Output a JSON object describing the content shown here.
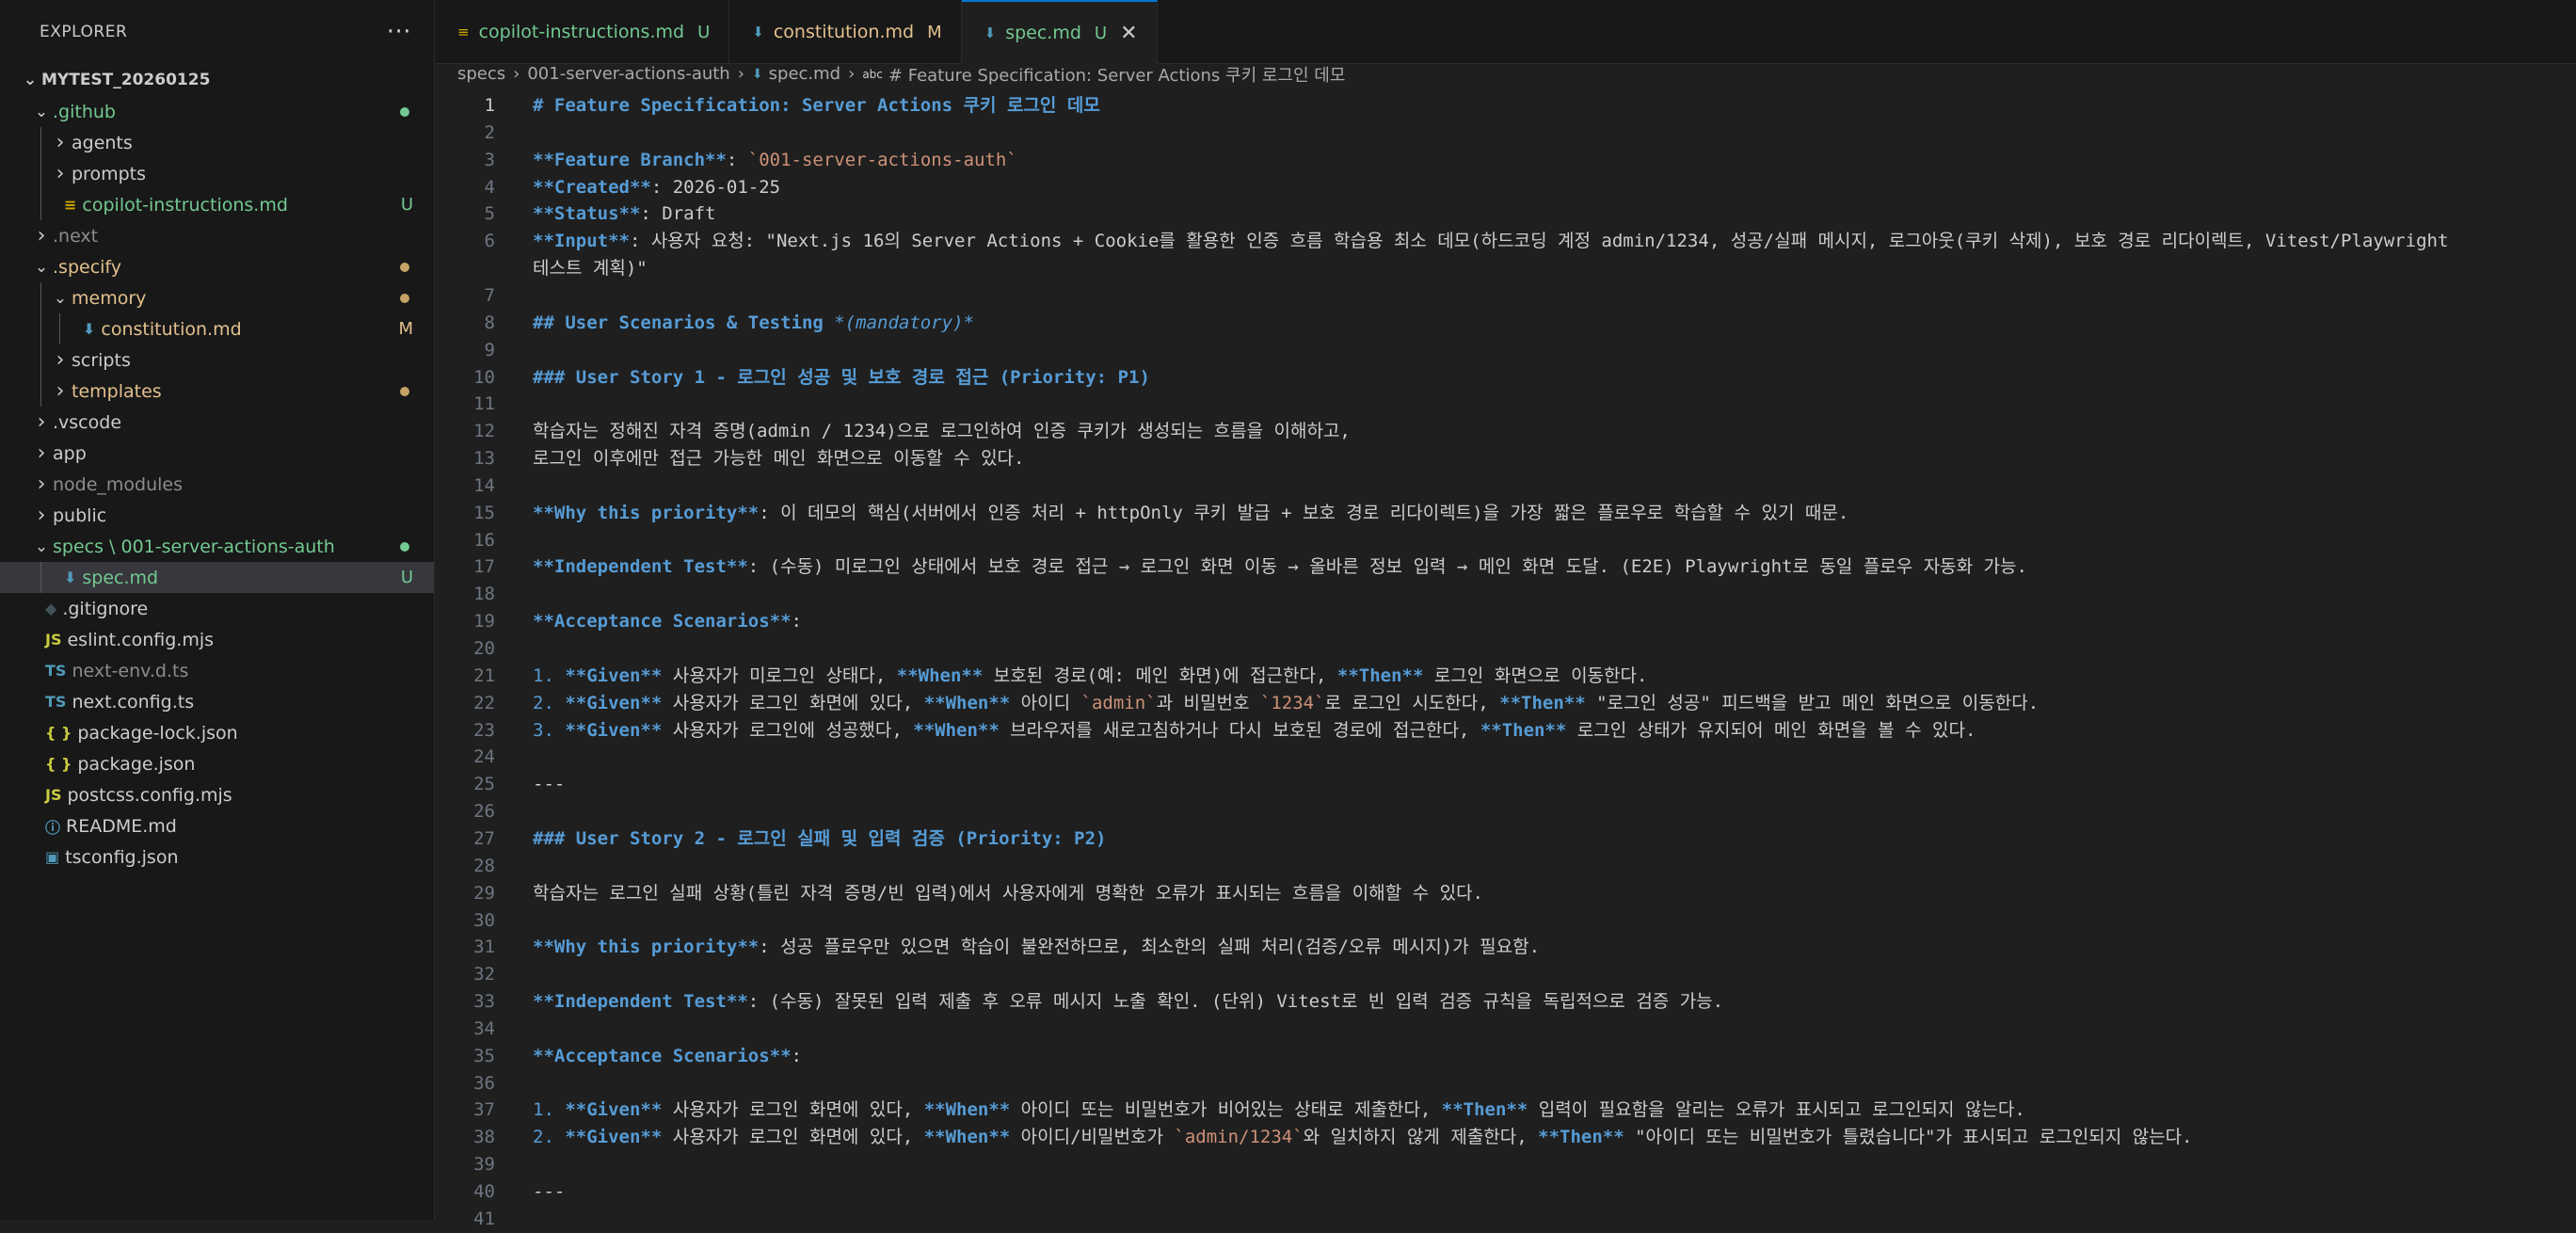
{
  "explorer": {
    "title": "EXPLORER",
    "more_icon": "···",
    "workspace": "MYTEST_20260125",
    "items": [
      {
        "label": ".github",
        "depth": 1,
        "chevron": "down",
        "color": "#73c991",
        "dot": "#73c991"
      },
      {
        "label": "agents",
        "depth": 2,
        "chevron": "right",
        "color": "#cccccc"
      },
      {
        "label": "prompts",
        "depth": 2,
        "chevron": "right",
        "color": "#cccccc"
      },
      {
        "label": "copilot-instructions.md",
        "depth": 2,
        "icon": "markdown-file-icon",
        "icon_char": "≡",
        "icon_color": "#cca700",
        "color": "#73c991",
        "status": "U",
        "status_color": "#73c991"
      },
      {
        "label": ".next",
        "depth": 1,
        "chevron": "right",
        "color": "#8c8c8c"
      },
      {
        "label": ".specify",
        "depth": 1,
        "chevron": "down",
        "color": "#e2c08d",
        "dot": "#c5a364"
      },
      {
        "label": "memory",
        "depth": 2,
        "chevron": "down",
        "color": "#e2c08d",
        "dot": "#c5a364"
      },
      {
        "label": "constitution.md",
        "depth": 3,
        "icon": "markdown-arrow-icon",
        "icon_char": "⬇",
        "icon_color": "#519aba",
        "color": "#e2c08d",
        "status": "M",
        "status_color": "#e2c08d"
      },
      {
        "label": "scripts",
        "depth": 2,
        "chevron": "right",
        "color": "#cccccc"
      },
      {
        "label": "templates",
        "depth": 2,
        "chevron": "right",
        "color": "#e2c08d",
        "dot": "#c5a364"
      },
      {
        "label": ".vscode",
        "depth": 1,
        "chevron": "right",
        "color": "#cccccc"
      },
      {
        "label": "app",
        "depth": 1,
        "chevron": "right",
        "color": "#cccccc"
      },
      {
        "label": "node_modules",
        "depth": 1,
        "chevron": "right",
        "color": "#8c8c8c"
      },
      {
        "label": "public",
        "depth": 1,
        "chevron": "right",
        "color": "#cccccc"
      },
      {
        "label": "specs \\ 001-server-actions-auth",
        "depth": 1,
        "chevron": "down",
        "color": "#73c991",
        "dot": "#73c991"
      },
      {
        "label": "spec.md",
        "depth": 2,
        "icon": "markdown-arrow-icon",
        "icon_char": "⬇",
        "icon_color": "#519aba",
        "color": "#73c991",
        "status": "U",
        "status_color": "#73c991",
        "selected": true
      },
      {
        "label": ".gitignore",
        "depth": 1,
        "icon": "git-icon",
        "icon_char": "◆",
        "icon_color": "#41535b",
        "color": "#cccccc"
      },
      {
        "label": "eslint.config.mjs",
        "depth": 1,
        "icon": "javascript-icon",
        "icon_char": "JS",
        "icon_color": "#cbcb41",
        "color": "#cccccc"
      },
      {
        "label": "next-env.d.ts",
        "depth": 1,
        "icon": "typescript-icon",
        "icon_char": "TS",
        "icon_color": "#519aba",
        "color": "#8c8c8c"
      },
      {
        "label": "next.config.ts",
        "depth": 1,
        "icon": "typescript-icon",
        "icon_char": "TS",
        "icon_color": "#519aba",
        "color": "#cccccc"
      },
      {
        "label": "package-lock.json",
        "depth": 1,
        "icon": "json-icon",
        "icon_char": "{ }",
        "icon_color": "#cbcb41",
        "color": "#cccccc"
      },
      {
        "label": "package.json",
        "depth": 1,
        "icon": "json-icon",
        "icon_char": "{ }",
        "icon_color": "#cbcb41",
        "color": "#cccccc"
      },
      {
        "label": "postcss.config.mjs",
        "depth": 1,
        "icon": "javascript-icon",
        "icon_char": "JS",
        "icon_color": "#cbcb41",
        "color": "#cccccc"
      },
      {
        "label": "README.md",
        "depth": 1,
        "icon": "info-icon",
        "icon_char": "ⓘ",
        "icon_color": "#519aba",
        "color": "#cccccc"
      },
      {
        "label": "tsconfig.json",
        "depth": 1,
        "icon": "tsconfig-icon",
        "icon_char": "▣",
        "icon_color": "#519aba",
        "color": "#cccccc"
      }
    ]
  },
  "tabs": [
    {
      "label": "copilot-instructions.md",
      "status": "U",
      "icon": "markdown-file-icon",
      "icon_char": "≡",
      "icon_color": "#cca700",
      "color": "#73c991"
    },
    {
      "label": "constitution.md",
      "status": "M",
      "icon": "markdown-arrow-icon",
      "icon_char": "⬇",
      "icon_color": "#519aba",
      "color": "#e2c08d"
    },
    {
      "label": "spec.md",
      "status": "U",
      "icon": "markdown-arrow-icon",
      "icon_char": "⬇",
      "icon_color": "#519aba",
      "color": "#73c991",
      "active": true,
      "close": "✕"
    }
  ],
  "breadcrumb": {
    "parts": [
      "specs",
      "001-server-actions-auth",
      "spec.md",
      "# Feature Specification: Server Actions 쿠키 로그인 데모"
    ],
    "separator": "›",
    "md_icon": "⬇",
    "symbol_icon": "abc"
  },
  "editor": {
    "current_line": 1,
    "lines": [
      {
        "n": 1,
        "seg": [
          [
            "h",
            "# Feature Specification: Server Actions 쿠키 로그인 데모"
          ]
        ]
      },
      {
        "n": 2,
        "seg": []
      },
      {
        "n": 3,
        "seg": [
          [
            "b",
            "**Feature Branch**"
          ],
          [
            "p",
            ": "
          ],
          [
            "c",
            "`001-server-actions-auth`"
          ]
        ]
      },
      {
        "n": 4,
        "seg": [
          [
            "b",
            "**Created**"
          ],
          [
            "p",
            ": 2026-01-25"
          ]
        ]
      },
      {
        "n": 5,
        "seg": [
          [
            "b",
            "**Status**"
          ],
          [
            "p",
            ": Draft"
          ]
        ]
      },
      {
        "n": 6,
        "seg": [
          [
            "b",
            "**Input**"
          ],
          [
            "p",
            ": 사용자 요청: \"Next.js 16의 Server Actions + Cookie를 활용한 인증 흐름 학습용 최소 데모(하드코딩 계정 admin/1234, 성공/실패 메시지, 로그아웃(쿠키 삭제), 보호 경로 리다이렉트, Vitest/Playwright"
          ]
        ]
      },
      {
        "n": null,
        "seg": [
          [
            "p",
            "테스트 계획)\""
          ]
        ]
      },
      {
        "n": 7,
        "seg": []
      },
      {
        "n": 8,
        "seg": [
          [
            "h",
            "## User Scenarios & Testing "
          ],
          [
            "i",
            "*(mandatory)*"
          ]
        ]
      },
      {
        "n": 9,
        "seg": []
      },
      {
        "n": 10,
        "seg": [
          [
            "h",
            "### User Story 1 - 로그인 성공 및 보호 경로 접근 (Priority: P1)"
          ]
        ]
      },
      {
        "n": 11,
        "seg": []
      },
      {
        "n": 12,
        "seg": [
          [
            "p",
            "학습자는 정해진 자격 증명(admin / 1234)으로 로그인하여 인증 쿠키가 생성되는 흐름을 이해하고,"
          ]
        ]
      },
      {
        "n": 13,
        "seg": [
          [
            "p",
            "로그인 이후에만 접근 가능한 메인 화면으로 이동할 수 있다."
          ]
        ]
      },
      {
        "n": 14,
        "seg": []
      },
      {
        "n": 15,
        "seg": [
          [
            "b",
            "**Why this priority**"
          ],
          [
            "p",
            ": 이 데모의 핵심(서버에서 인증 처리 + httpOnly 쿠키 발급 + 보호 경로 리다이렉트)을 가장 짧은 플로우로 학습할 수 있기 때문."
          ]
        ]
      },
      {
        "n": 16,
        "seg": []
      },
      {
        "n": 17,
        "seg": [
          [
            "b",
            "**Independent Test**"
          ],
          [
            "p",
            ": (수동) 미로그인 상태에서 보호 경로 접근 → 로그인 화면 이동 → 올바른 정보 입력 → 메인 화면 도달. (E2E) Playwright로 동일 플로우 자동화 가능."
          ]
        ]
      },
      {
        "n": 18,
        "seg": []
      },
      {
        "n": 19,
        "seg": [
          [
            "b",
            "**Acceptance Scenarios**"
          ],
          [
            "p",
            ":"
          ]
        ]
      },
      {
        "n": 20,
        "seg": []
      },
      {
        "n": 21,
        "seg": [
          [
            "m",
            "1. "
          ],
          [
            "b",
            "**Given**"
          ],
          [
            "p",
            " 사용자가 미로그인 상태다, "
          ],
          [
            "b",
            "**When**"
          ],
          [
            "p",
            " 보호된 경로(예: 메인 화면)에 접근한다, "
          ],
          [
            "b",
            "**Then**"
          ],
          [
            "p",
            " 로그인 화면으로 이동한다."
          ]
        ]
      },
      {
        "n": 22,
        "seg": [
          [
            "m",
            "2. "
          ],
          [
            "b",
            "**Given**"
          ],
          [
            "p",
            " 사용자가 로그인 화면에 있다, "
          ],
          [
            "b",
            "**When**"
          ],
          [
            "p",
            " 아이디 "
          ],
          [
            "c",
            "`admin`"
          ],
          [
            "p",
            "과 비밀번호 "
          ],
          [
            "c",
            "`1234`"
          ],
          [
            "p",
            "로 로그인 시도한다, "
          ],
          [
            "b",
            "**Then**"
          ],
          [
            "p",
            " \"로그인 성공\" 피드백을 받고 메인 화면으로 이동한다."
          ]
        ]
      },
      {
        "n": 23,
        "seg": [
          [
            "m",
            "3. "
          ],
          [
            "b",
            "**Given**"
          ],
          [
            "p",
            " 사용자가 로그인에 성공했다, "
          ],
          [
            "b",
            "**When**"
          ],
          [
            "p",
            " 브라우저를 새로고침하거나 다시 보호된 경로에 접근한다, "
          ],
          [
            "b",
            "**Then**"
          ],
          [
            "p",
            " 로그인 상태가 유지되어 메인 화면을 볼 수 있다."
          ]
        ]
      },
      {
        "n": 24,
        "seg": []
      },
      {
        "n": 25,
        "seg": [
          [
            "p",
            "---"
          ]
        ]
      },
      {
        "n": 26,
        "seg": []
      },
      {
        "n": 27,
        "seg": [
          [
            "h",
            "### User Story 2 - 로그인 실패 및 입력 검증 (Priority: P2)"
          ]
        ]
      },
      {
        "n": 28,
        "seg": []
      },
      {
        "n": 29,
        "seg": [
          [
            "p",
            "학습자는 로그인 실패 상황(틀린 자격 증명/빈 입력)에서 사용자에게 명확한 오류가 표시되는 흐름을 이해할 수 있다."
          ]
        ]
      },
      {
        "n": 30,
        "seg": []
      },
      {
        "n": 31,
        "seg": [
          [
            "b",
            "**Why this priority**"
          ],
          [
            "p",
            ": 성공 플로우만 있으면 학습이 불완전하므로, 최소한의 실패 처리(검증/오류 메시지)가 필요함."
          ]
        ]
      },
      {
        "n": 32,
        "seg": []
      },
      {
        "n": 33,
        "seg": [
          [
            "b",
            "**Independent Test**"
          ],
          [
            "p",
            ": (수동) 잘못된 입력 제출 후 오류 메시지 노출 확인. (단위) Vitest로 빈 입력 검증 규칙을 독립적으로 검증 가능."
          ]
        ]
      },
      {
        "n": 34,
        "seg": []
      },
      {
        "n": 35,
        "seg": [
          [
            "b",
            "**Acceptance Scenarios**"
          ],
          [
            "p",
            ":"
          ]
        ]
      },
      {
        "n": 36,
        "seg": []
      },
      {
        "n": 37,
        "seg": [
          [
            "m",
            "1. "
          ],
          [
            "b",
            "**Given**"
          ],
          [
            "p",
            " 사용자가 로그인 화면에 있다, "
          ],
          [
            "b",
            "**When**"
          ],
          [
            "p",
            " 아이디 또는 비밀번호가 비어있는 상태로 제출한다, "
          ],
          [
            "b",
            "**Then**"
          ],
          [
            "p",
            " 입력이 필요함을 알리는 오류가 표시되고 로그인되지 않는다."
          ]
        ]
      },
      {
        "n": 38,
        "seg": [
          [
            "m",
            "2. "
          ],
          [
            "b",
            "**Given**"
          ],
          [
            "p",
            " 사용자가 로그인 화면에 있다, "
          ],
          [
            "b",
            "**When**"
          ],
          [
            "p",
            " 아이디/비밀번호가 "
          ],
          [
            "c",
            "`admin/1234`"
          ],
          [
            "p",
            "와 일치하지 않게 제출한다, "
          ],
          [
            "b",
            "**Then**"
          ],
          [
            "p",
            " \"아이디 또는 비밀번호가 틀렸습니다\"가 표시되고 로그인되지 않는다."
          ]
        ]
      },
      {
        "n": 39,
        "seg": []
      },
      {
        "n": 40,
        "seg": [
          [
            "p",
            "---"
          ]
        ]
      },
      {
        "n": 41,
        "seg": []
      }
    ]
  }
}
